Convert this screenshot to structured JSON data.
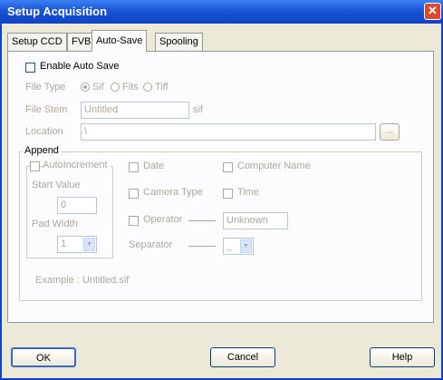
{
  "window": {
    "title": "Setup Acquisition"
  },
  "tabs": [
    {
      "label": "Setup CCD"
    },
    {
      "label": "FVB"
    },
    {
      "label": "Auto-Save"
    },
    {
      "label": "Spooling"
    }
  ],
  "autosave": {
    "enable_label": "Enable Auto Save",
    "enabled": false,
    "file_type_label": "File Type",
    "file_types": [
      "Sif",
      "Fits",
      "Tiff"
    ],
    "selected_file_type": "Sif",
    "file_stem_label": "File Stem",
    "file_stem_value": "Untitled",
    "file_stem_ext": "sif",
    "location_label": "Location",
    "location_value": "\\",
    "browse_label": "..."
  },
  "append": {
    "label": "Append",
    "autoincrement_label": "AutoIncrement",
    "start_value_label": "Start Value",
    "start_value": "0",
    "pad_width_label": "Pad Width",
    "pad_width": "1",
    "date_label": "Date",
    "camera_type_label": "Camera Type",
    "operator_label": "Operator",
    "operator_value": "Unknown",
    "computer_name_label": "Computer Name",
    "time_label": "Time",
    "separator_label": "Separator",
    "separator_value": "_"
  },
  "example": "Example : Untitled.sif",
  "buttons": {
    "ok": "OK",
    "cancel": "Cancel",
    "help": "Help"
  }
}
